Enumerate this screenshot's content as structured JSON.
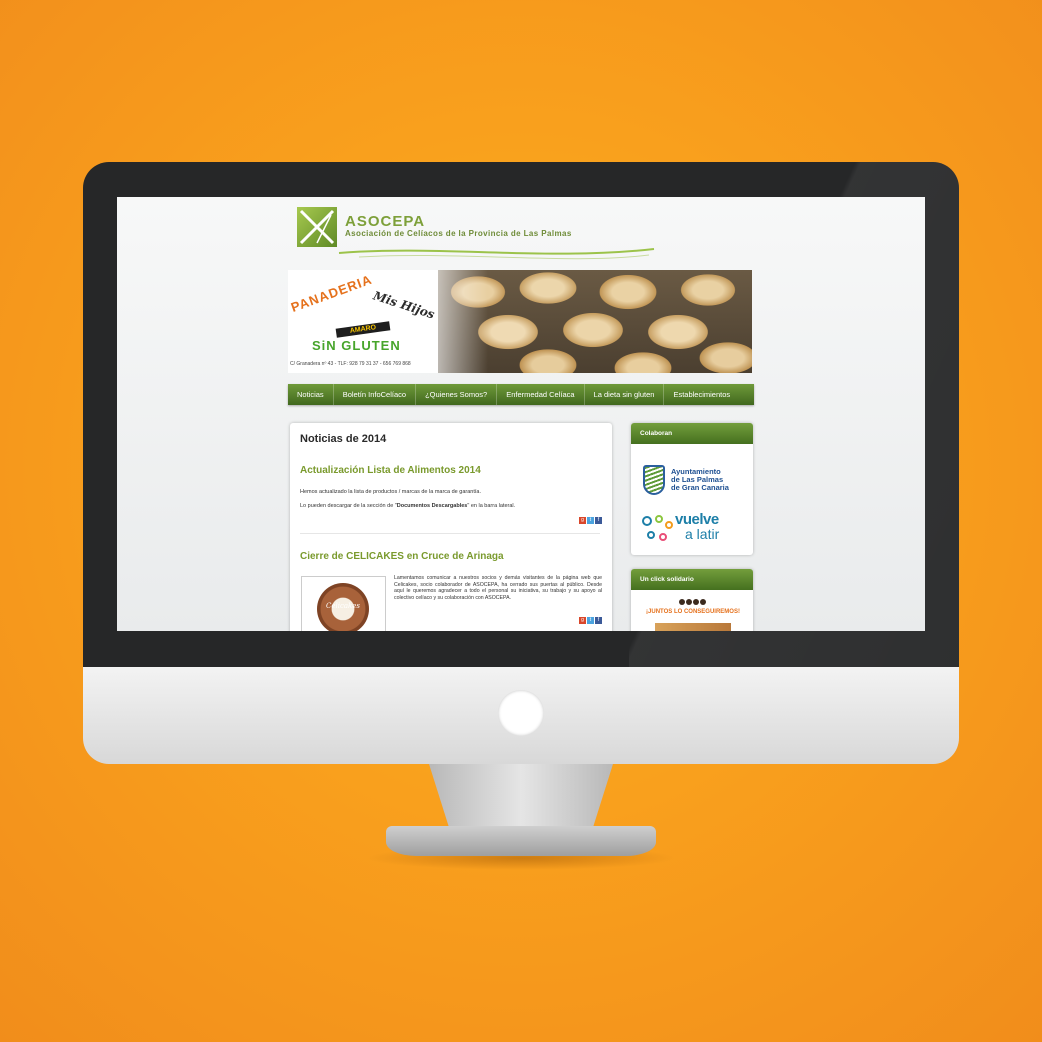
{
  "site": {
    "brand": "ASOCEPA",
    "tagline": "Asociación de Celíacos de la Provincia de Las Palmas"
  },
  "banner": {
    "panaderia": "PANADERIA",
    "mis_hijos": "Mis Hijos",
    "amaro": "AMARO",
    "sin_gluten": "SiN GLUTEN",
    "address": "C/ Granadera nº 43 - TLF: 928 79 31 37 - 656 769 868"
  },
  "nav": {
    "items": [
      "Noticias",
      "Boletín InfoCelíaco",
      "¿Quienes Somos?",
      "Enfermedad Celíaca",
      "La dieta sin gluten",
      "Establecimientos"
    ]
  },
  "main": {
    "title": "Noticias de 2014",
    "posts": [
      {
        "title": "Actualización Lista de Alimentos 2014",
        "text1": "Hemos actualizado la lista de productos / marcas de la marca de garantía.",
        "text2_pre": "Lo pueden descargar de la sección de \"",
        "text2_bold": "Documentos Descargables",
        "text2_post": "\" en la barra lateral."
      },
      {
        "title": "Cierre de CELICAKES en Cruce de Arinaga",
        "image_text": "Celicakes",
        "text": "Lamentamos comunicar a nuestros socios y demás visitantes de la página web que Celicakes, socio colaborador de ASOCEPA, ha cerrado sus puertas al público. Desde aquí le queremos agradecer a todo el personal su iniciativa, su trabajo y su apoyo al colectivo celíaco y su colaboración con ASOCEPA."
      }
    ]
  },
  "sidebar": {
    "colaboran": {
      "heading": "Colaboran",
      "ayuntamiento": [
        "Ayuntamiento",
        "de Las Palmas",
        "de Gran Canaria"
      ],
      "vuelve": "vuelve",
      "a_latir": "a latir"
    },
    "click_solidario": {
      "heading": "Un click solidario",
      "banner_text": "¡JUNTOS LO CONSEGUIREMOS!"
    }
  },
  "share_icons": [
    "google-plus-icon",
    "twitter-icon",
    "facebook-icon"
  ],
  "colors": {
    "background_orange": "#f9a01d",
    "nav_green": "#41681e",
    "post_title_green": "#7a9a2d",
    "bezel": "#262728"
  }
}
